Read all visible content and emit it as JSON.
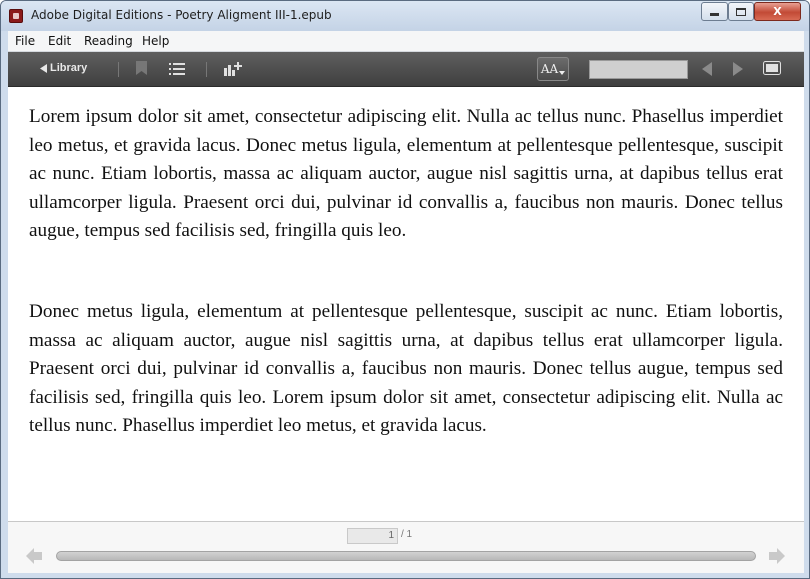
{
  "window": {
    "title": "Adobe Digital Editions - Poetry Aligment III-1.epub",
    "icon": "adobe-digital-editions-icon"
  },
  "window_controls": {
    "close_label": "X"
  },
  "menu": {
    "items": [
      {
        "label": "File"
      },
      {
        "label": "Edit"
      },
      {
        "label": "Reading"
      },
      {
        "label": "Help"
      }
    ]
  },
  "toolbar": {
    "library_label": "Library",
    "font_size_label": "AA",
    "icons": [
      "bookmark-icon",
      "table-of-contents-icon",
      "chart-add-icon",
      "previous-page-icon",
      "next-page-icon",
      "fullscreen-icon"
    ]
  },
  "content": {
    "paragraphs": [
      "Lorem ipsum dolor sit amet, consectetur adipiscing elit. Nulla ac tellus nunc. Phasellus imperdiet leo metus, et gravida lacus. Donec metus ligula, elementum at pellentesque pellentesque, suscipit ac nunc. Etiam lobortis, massa ac aliquam auctor, augue nisl sagittis urna, at dapibus tellus erat ullamcorper ligula. Praesent orci dui, pulvinar id convallis a, faucibus non mauris. Donec tellus augue, tempus sed facilisis sed, fringilla quis leo.",
      "Donec metus ligula, elementum at pellentesque pellentesque, suscipit ac nunc. Etiam lobortis, massa ac aliquam auctor, augue nisl sagittis urna, at dapibus tellus erat ullamcorper ligula. Praesent orci dui, pulvinar id convallis a, faucibus non mauris. Donec tellus augue, tempus sed facilisis sed, fringilla quis leo. Lorem ipsum dolor sit amet, consectetur adipiscing elit. Nulla ac tellus nunc. Phasellus imperdiet leo metus, et gravida lacus."
    ]
  },
  "pagination": {
    "current_page": "1",
    "total_pages": "/ 1"
  }
}
